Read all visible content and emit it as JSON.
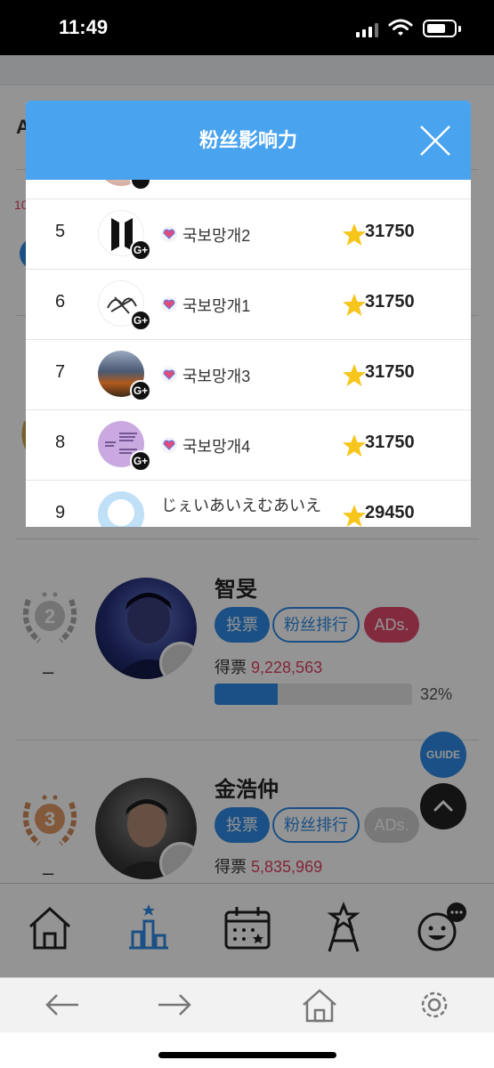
{
  "status": {
    "time": "11:49"
  },
  "page": {
    "ghost_initial": "A",
    "ghost_count": "10",
    "candidates": [
      {
        "rank": "2",
        "rank_change": "–",
        "name": "智旻",
        "vote_label": "投票",
        "rank_label": "粉丝排行",
        "ads_label": "ADs.",
        "votes_label": "得票",
        "votes": "9,228,563",
        "percent_text": "32%",
        "percent": 32
      },
      {
        "rank": "3",
        "rank_change": "–",
        "name": "金浩仲",
        "vote_label": "投票",
        "rank_label": "粉丝排行",
        "ads_label": "ADs.",
        "votes_label": "得票",
        "votes": "5,835,969"
      }
    ],
    "guide_label": "GUIDE"
  },
  "modal": {
    "title": "粉丝影响力",
    "rows": [
      {
        "rank": "5",
        "name": "국보망개2",
        "score": "31750",
        "badge": "G+"
      },
      {
        "rank": "6",
        "name": "국보망개1",
        "score": "31750",
        "badge": "G+"
      },
      {
        "rank": "7",
        "name": "국보망개3",
        "score": "31750",
        "badge": "G+"
      },
      {
        "rank": "8",
        "name": "국보망개4",
        "score": "31750",
        "badge": "G+"
      },
      {
        "rank": "9",
        "name": "じぇいあいえむあいえ",
        "score": "29450",
        "badge": ""
      }
    ]
  },
  "colors": {
    "header": "#4aa3ef",
    "accent": "#2e8ae6",
    "pink": "#e04a6c",
    "star": "#f6c61c"
  },
  "icons": {
    "appnav": [
      "home-icon",
      "ranking-icon",
      "calendar-icon",
      "idol-star-icon",
      "smiley-chat-icon"
    ],
    "browser": [
      "back-arrow-icon",
      "forward-arrow-icon",
      "home-icon",
      "settings-gear-icon"
    ]
  }
}
